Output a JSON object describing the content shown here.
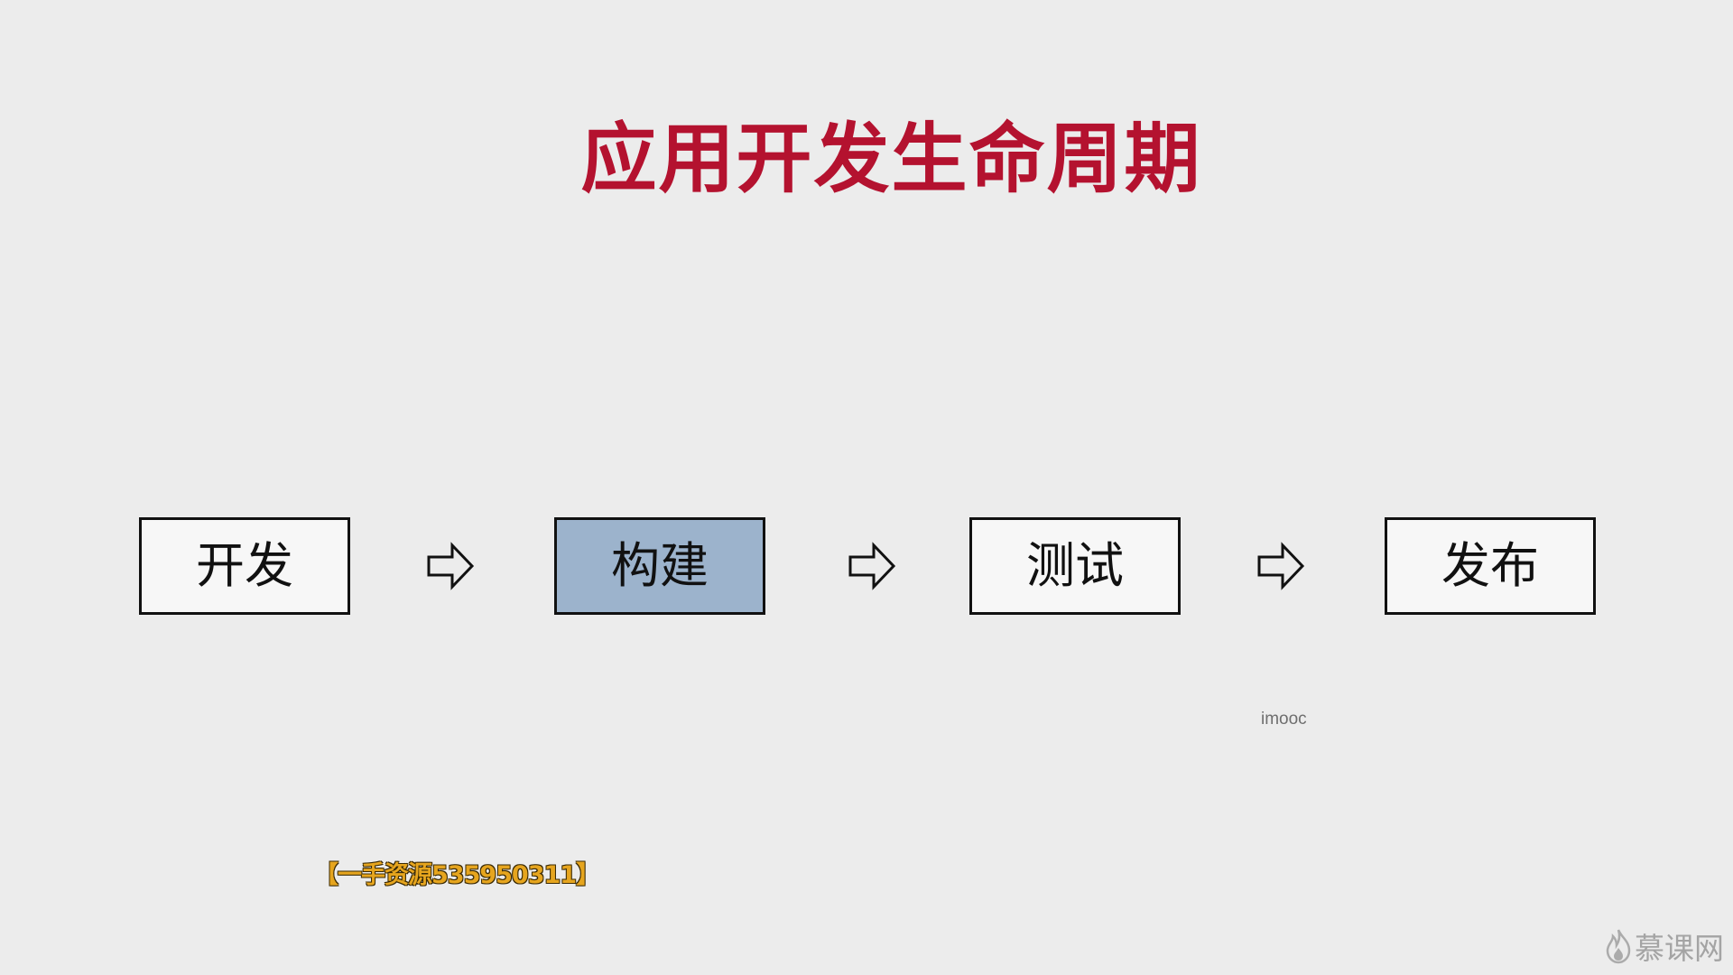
{
  "slide": {
    "title": "应用开发生命周期",
    "title_color": "#b4122f"
  },
  "flow": {
    "steps": [
      {
        "label": "开发",
        "highlighted": false
      },
      {
        "label": "构建",
        "highlighted": true
      },
      {
        "label": "测试",
        "highlighted": false
      },
      {
        "label": "发布",
        "highlighted": false
      }
    ],
    "arrow_icon": "right-arrow-outline-icon",
    "highlight_color": "#9cb3cc"
  },
  "watermarks": {
    "small_text": "imooc",
    "promo_text": "【一手资源535950311】",
    "brand_text": "慕课网",
    "brand_icon": "flame-logo-icon"
  }
}
